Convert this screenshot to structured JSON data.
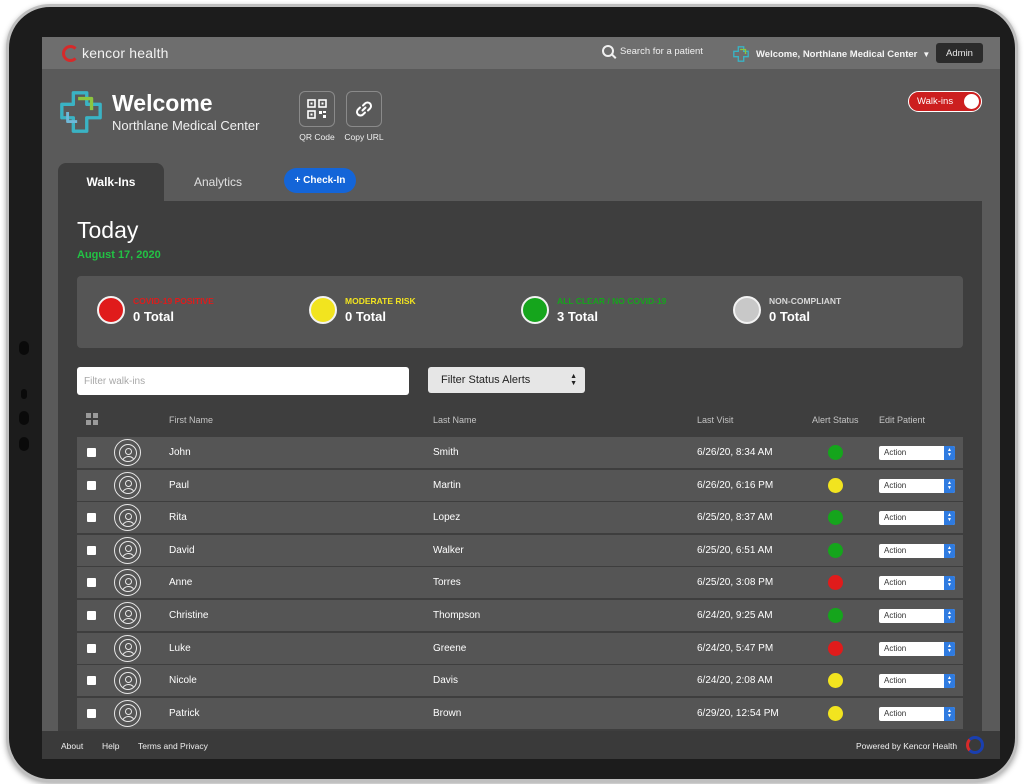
{
  "app": {
    "name": "kencor health",
    "search_label": "Search for a patient",
    "welcome_label": "Welcome, Northlane Medical Center",
    "admin_label": "Admin"
  },
  "header": {
    "title": "Welcome",
    "subtitle": "Northlane Medical Center",
    "qr_label": "QR Code",
    "copy_url_label": "Copy URL",
    "walkins_toggle_label": "Walk-ins",
    "walkins_toggle_on": true
  },
  "tabs": [
    {
      "label": "Walk-Ins",
      "active": true
    },
    {
      "label": "Analytics",
      "active": false
    }
  ],
  "checkin_label": "+ Check-In",
  "today": {
    "title": "Today",
    "date": "August 17, 2020"
  },
  "summary": [
    {
      "label": "COVID-19 POSITIVE",
      "count": "0",
      "suffix": "Total",
      "color": "#e01b1b",
      "label_color": "#e01b1b"
    },
    {
      "label": "MODERATE RISK",
      "count": "0",
      "suffix": "Total",
      "color": "#f2e41f",
      "label_color": "#f2e41f"
    },
    {
      "label": "ALL CLEAR / NO COVID-19",
      "count": "3",
      "suffix": "Total",
      "color": "#15a51c",
      "label_color": "#15a51c"
    },
    {
      "label": "NON-COMPLIANT",
      "count": "0",
      "suffix": "Total",
      "color": "#c8c8c8",
      "label_color": "#d8d8d8"
    }
  ],
  "filters": {
    "walkins_placeholder": "Filter walk-ins",
    "status_label": "Filter Status Alerts"
  },
  "columns": {
    "first": "First Name",
    "last": "Last Name",
    "visit": "Last Visit",
    "status": "Alert Status",
    "edit": "Edit Patient"
  },
  "status_colors": {
    "green": "#15a51c",
    "yellow": "#f2e41f",
    "red": "#e01b1b"
  },
  "patients": [
    {
      "first": "John",
      "last": "Smith",
      "visit": "6/26/20, 8:34 AM",
      "status": "green",
      "action": "Action"
    },
    {
      "first": "Paul",
      "last": "Martin",
      "visit": "6/26/20, 6:16 PM",
      "status": "yellow",
      "action": "Action"
    },
    {
      "first": "Rita",
      "last": "Lopez",
      "visit": "6/25/20, 8:37 AM",
      "status": "green",
      "action": "Action"
    },
    {
      "first": "David",
      "last": "Walker",
      "visit": "6/25/20, 6:51 AM",
      "status": "green",
      "action": "Action"
    },
    {
      "first": "Anne",
      "last": "Torres",
      "visit": "6/25/20, 3:08 PM",
      "status": "red",
      "action": "Action"
    },
    {
      "first": "Christine",
      "last": "Thompson",
      "visit": "6/24/20, 9:25 AM",
      "status": "green",
      "action": "Action"
    },
    {
      "first": "Luke",
      "last": "Greene",
      "visit": "6/24/20, 5:47 PM",
      "status": "red",
      "action": "Action"
    },
    {
      "first": "Nicole",
      "last": "Davis",
      "visit": "6/24/20, 2:08 AM",
      "status": "yellow",
      "action": "Action"
    },
    {
      "first": "Patrick",
      "last": "Brown",
      "visit": "6/29/20, 12:54 PM",
      "status": "yellow",
      "action": "Action"
    }
  ],
  "footer": {
    "about": "About",
    "help": "Help",
    "terms": "Terms and Privacy",
    "powered": "Powered by Kencor Health"
  }
}
